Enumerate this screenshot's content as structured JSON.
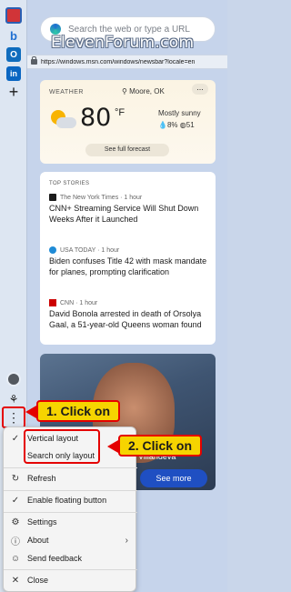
{
  "search": {
    "placeholder": "Search the web or type a URL"
  },
  "watermark": "ElevenForum.com",
  "url": "https://windows.msn.com/windows/newsbar?locale=en",
  "weather": {
    "title": "WEATHER",
    "location": "Moore, OK",
    "more": "...",
    "temperature": "80",
    "unit": "°F",
    "condition": "Mostly sunny",
    "precip": "8%",
    "aqi": "51",
    "forecast_button": "See full forecast"
  },
  "stories": {
    "title": "TOP STORIES",
    "items": [
      {
        "source": "The New York Times · 1 hour",
        "headline": "CNN+ Streaming Service Will Shut Down Weeks After it Launched"
      },
      {
        "source": "USA TODAY · 1 hour",
        "headline": "Biden confuses Title 42 with mask mandate for planes, prompting clarification"
      },
      {
        "source": "CNN · 1 hour",
        "headline": "David Bonola arrested in death of Orsolya Gaal, a 51-year-old Queens woman found"
      }
    ]
  },
  "photo": {
    "caption": "Villanueva"
  },
  "see_more": "See more",
  "callouts": {
    "step1": "1. Click on",
    "step2": "2. Click on"
  },
  "menu": {
    "items": [
      {
        "label": "Vertical layout",
        "glyph": "✓"
      },
      {
        "label": "Search only layout",
        "glyph": ""
      },
      {
        "label": "Refresh",
        "glyph": "↻"
      },
      {
        "label": "Enable floating button",
        "glyph": "✓"
      },
      {
        "label": "Settings",
        "glyph": "⚙"
      },
      {
        "label": "About",
        "glyph": "ⓘ"
      },
      {
        "label": "Send feedback",
        "glyph": "☺"
      },
      {
        "label": "Close",
        "glyph": "✕"
      }
    ],
    "about_chevron": "›"
  },
  "sidebar": {
    "icons": [
      "news-icon",
      "bing-icon",
      "outlook-icon",
      "linkedin-icon",
      "add-icon",
      "avatar",
      "copilot-icon",
      "more-icon"
    ],
    "outlook_letter": "O",
    "linkedin_letter": "in",
    "bing_letter": "b",
    "add_glyph": "+",
    "more_glyph": "⋮",
    "copilot_glyph": "⚘"
  },
  "colors": {
    "accent": "#1f4fc2",
    "callout_fill": "#f6d400",
    "callout_border": "#e40000"
  }
}
